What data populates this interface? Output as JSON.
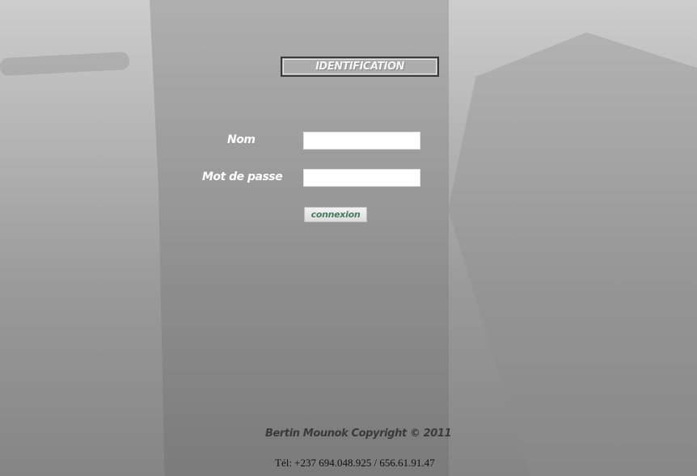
{
  "form": {
    "title": "IDENTIFICATION",
    "name_label": "Nom",
    "name_value": "",
    "password_label": "Mot de passe",
    "password_value": "",
    "submit_label": "connexion"
  },
  "footer": {
    "copyright": "Bertin Mounok Copyright © 2011",
    "phone": "Tél: +237 694.048.925 / 656.61.91.47"
  },
  "colors": {
    "label_text": "#ffffff",
    "button_text": "#4a7a62",
    "copyright_text": "#3a3a3a"
  }
}
